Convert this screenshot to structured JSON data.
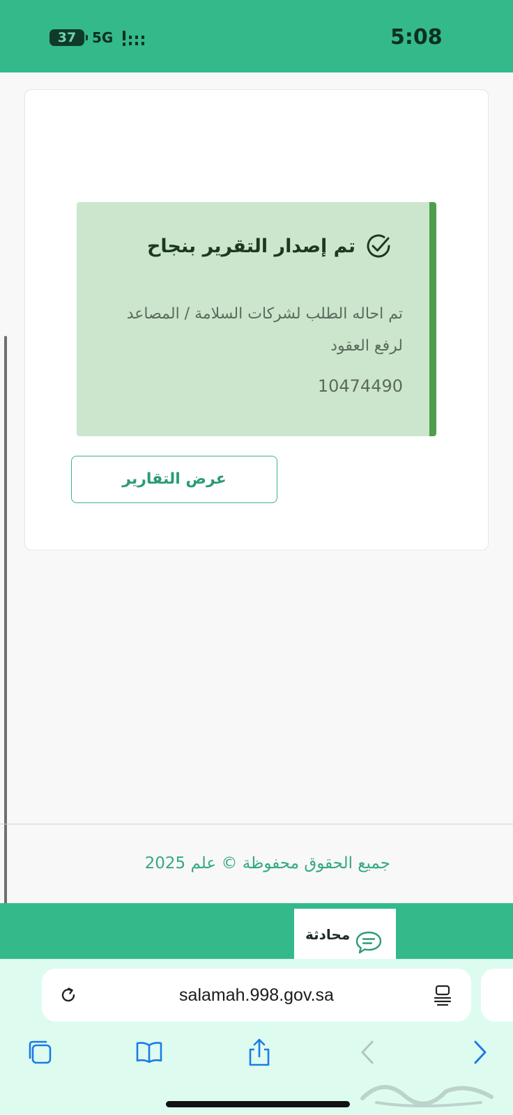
{
  "status_bar": {
    "battery": "37",
    "network": "5G",
    "time": "5:08"
  },
  "alert": {
    "title": "تم إصدار التقرير بنجاح",
    "message": "تم احاله الطلب لشركات السلامة / المصاعد لرفع العقود",
    "request_number": "10474490"
  },
  "actions": {
    "view_reports_label": "عرض التقارير"
  },
  "footer": {
    "copyright": "جميع الحقوق محفوظة © علم 2025"
  },
  "chat": {
    "label": "محادثة"
  },
  "browser": {
    "url": "salamah.998.gov.sa"
  },
  "icons": {
    "status_icon": "check-circle-icon",
    "chat_icon": "chat-bubble-icon",
    "reload_icon": "reload-icon",
    "reader_icon": "reader-mode-icon",
    "tabs_icon": "tabs-icon",
    "bookmarks_icon": "book-icon",
    "share_icon": "share-icon",
    "back_icon": "chevron-left-icon",
    "forward_icon": "chevron-right-icon"
  },
  "colors": {
    "brand_green": "#34b98a",
    "alert_background": "#cbe6cd",
    "alert_accent": "#4e9e4c",
    "link_green": "#2b9b74",
    "ios_blue": "#1a7be8"
  }
}
